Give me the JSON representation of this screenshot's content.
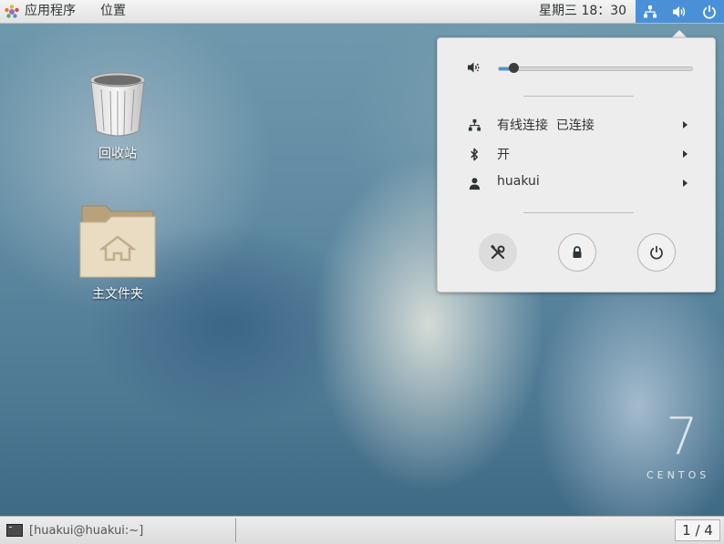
{
  "topbar": {
    "apps_label": "应用程序",
    "places_label": "位置",
    "clock": "星期三 18：30",
    "accent_color": "#4a90d9"
  },
  "popup": {
    "volume": {
      "level": 0.07
    },
    "items": [
      {
        "label": "有线连接  已连接",
        "icon": "network-wired-icon"
      },
      {
        "label": "开",
        "icon": "bluetooth-icon"
      },
      {
        "label": "huakui",
        "icon": "user-icon"
      }
    ],
    "buttons": [
      {
        "icon": "settings-tools-icon"
      },
      {
        "icon": "lock-icon"
      },
      {
        "icon": "power-icon"
      }
    ]
  },
  "desktop": {
    "icons": [
      {
        "label": "回收站",
        "icon": "trash-icon"
      },
      {
        "label": "主文件夹",
        "icon": "home-folder-icon"
      }
    ],
    "watermark_number": "7",
    "watermark_text": "CENTOS"
  },
  "taskbar": {
    "window_title": "[huakui@huakui:~]",
    "workspace": "1 / 4"
  }
}
